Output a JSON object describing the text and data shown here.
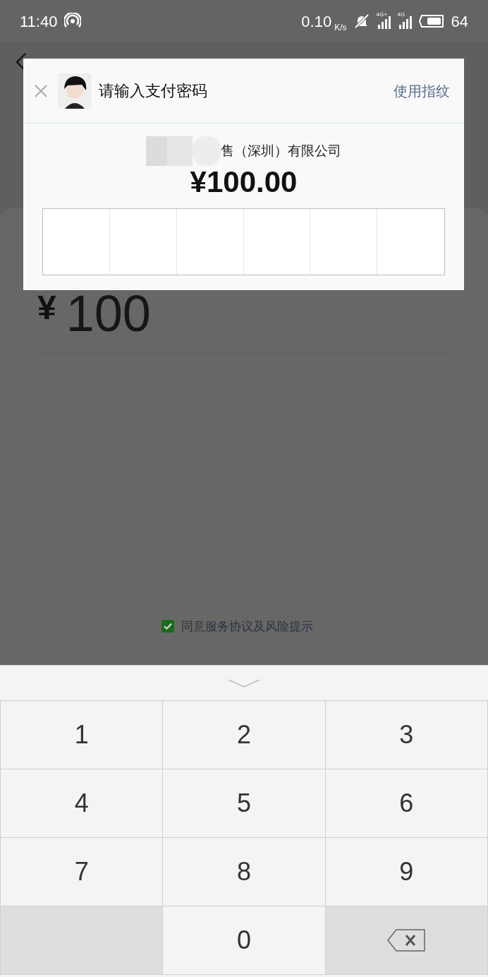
{
  "status_bar": {
    "time": "11:40",
    "speed": "0.10",
    "speed_unit": "K/s",
    "network_1": "4G+",
    "network_2": "4G",
    "battery": "64"
  },
  "page": {
    "amount_symbol": "¥",
    "amount": "100",
    "agreement": {
      "checked": true,
      "prefix": "同意",
      "link": "服务协议及风险提示"
    }
  },
  "dialog": {
    "title": "请输入支付密码",
    "fingerprint_link": "使用指纹",
    "merchant": "售（深圳）有限公司",
    "amount": "¥100.00",
    "pin_cells": [
      {
        "filled": false
      },
      {
        "filled": false
      },
      {
        "filled": false
      },
      {
        "filled": false
      },
      {
        "filled": false
      },
      {
        "filled": false
      }
    ]
  },
  "keypad": {
    "keys": [
      {
        "kind": "digit",
        "label": "1"
      },
      {
        "kind": "digit",
        "label": "2"
      },
      {
        "kind": "digit",
        "label": "3"
      },
      {
        "kind": "digit",
        "label": "4"
      },
      {
        "kind": "digit",
        "label": "5"
      },
      {
        "kind": "digit",
        "label": "6"
      },
      {
        "kind": "digit",
        "label": "7"
      },
      {
        "kind": "digit",
        "label": "8"
      },
      {
        "kind": "digit",
        "label": "9"
      },
      {
        "kind": "blank"
      },
      {
        "kind": "digit",
        "label": "0"
      },
      {
        "kind": "delete"
      }
    ]
  }
}
